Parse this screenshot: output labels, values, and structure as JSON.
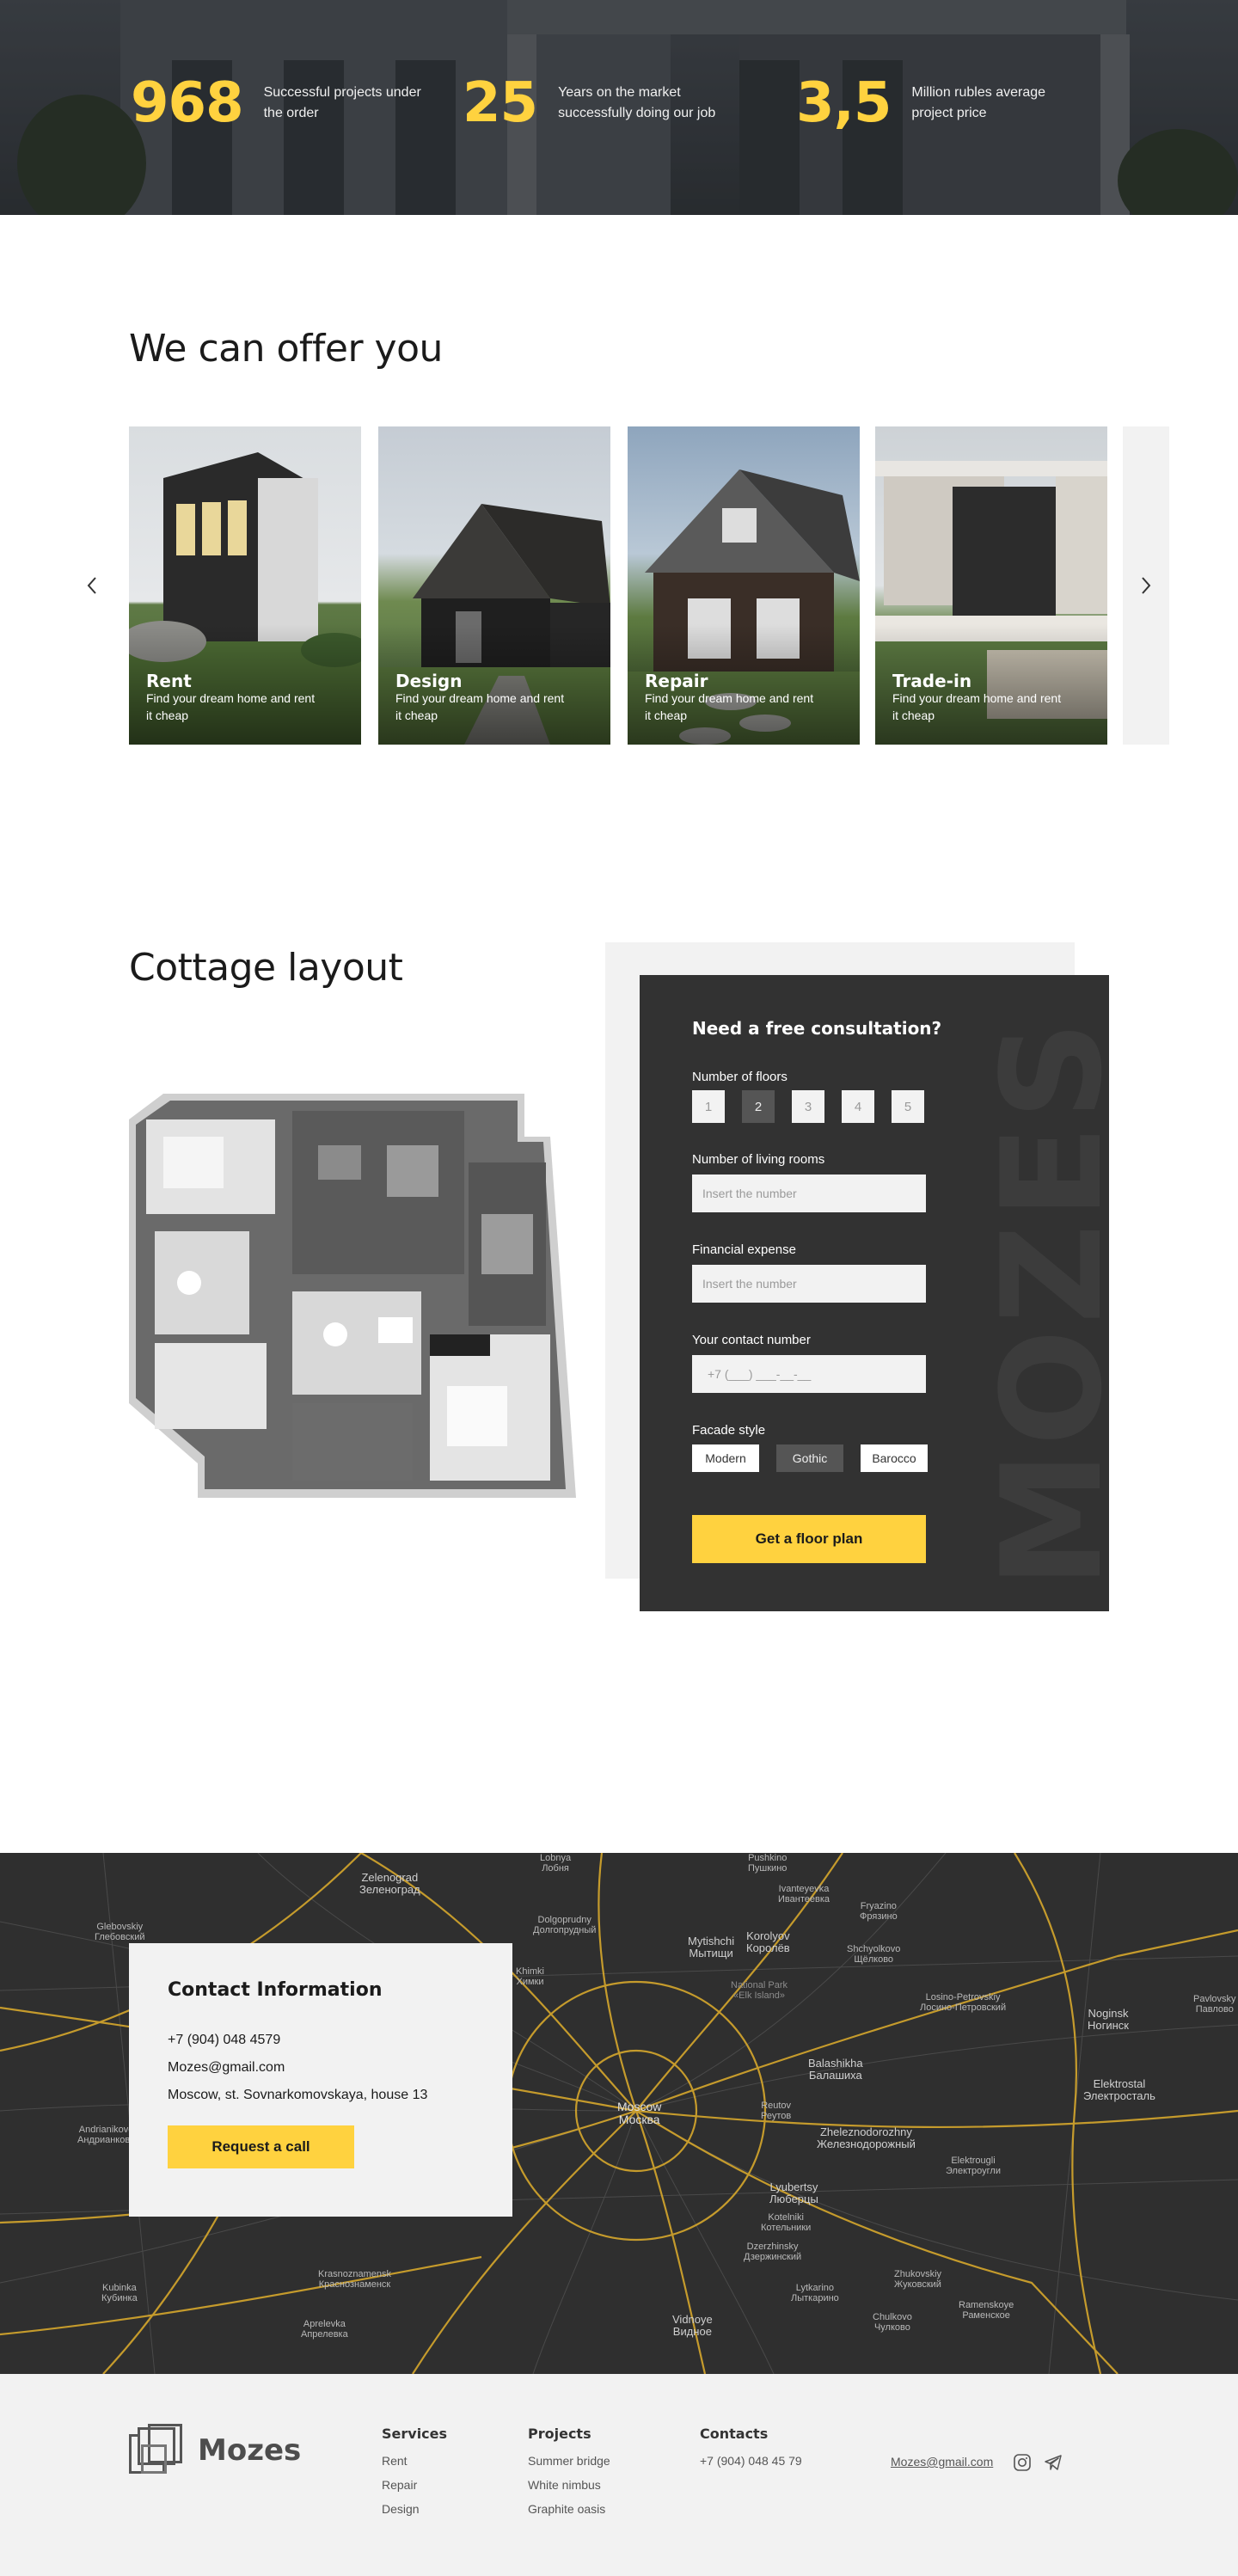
{
  "stats": [
    {
      "number": "968",
      "text": "Successful projects under the order"
    },
    {
      "number": "25",
      "text": "Years on the market successfully doing our job"
    },
    {
      "number": "3,5",
      "text": "Million rubles average project price"
    }
  ],
  "offer": {
    "title": "We can offer you",
    "cards": [
      {
        "title": "Rent",
        "desc": "Find your dream home and rent it cheap"
      },
      {
        "title": "Design",
        "desc": "Find your dream home and rent it cheap"
      },
      {
        "title": "Repair",
        "desc": "Find your dream home and rent it cheap"
      },
      {
        "title": "Trade-in",
        "desc": "Find your dream home and rent it cheap"
      }
    ],
    "prev_icon": "chevron-left-icon",
    "next_icon": "chevron-right-icon"
  },
  "layout": {
    "title": "Cottage layout"
  },
  "form": {
    "title": "Need a free consultation?",
    "brand_watermark": "MOZES",
    "floors_label": "Number of floors",
    "floors": [
      "1",
      "2",
      "3",
      "4",
      "5"
    ],
    "floors_selected": "2",
    "rooms_label": "Number of living rooms",
    "rooms_placeholder": "Insert the number",
    "expense_label": "Financial expense",
    "expense_placeholder": "Insert the number",
    "phone_label": "Your contact number",
    "phone_placeholder": "+7 (___) ___-__-__",
    "facade_label": "Facade style",
    "facades": [
      "Modern",
      "Gothic",
      "Barocco"
    ],
    "facade_selected": "Gothic",
    "submit": "Get a floor plan"
  },
  "contact": {
    "title": "Contact Information",
    "phone": "+7 (904) 048 4579",
    "email": "Mozes@gmail.com",
    "address": "Moscow, st. Sovnarkomovskaya, house 13",
    "button": "Request a call"
  },
  "map_labels": {
    "moscow": "Moscow\nМосква",
    "zelenograd": "Zelenograd\nЗеленоград",
    "mytishchi": "Mytishchi\nМытищи",
    "korolyov": "Korolyov\nКоролёв",
    "balashikha": "Balashikha\nБалашиха",
    "lyubertsy": "Lyubertsy\nЛюберцы",
    "khimki": "Khimki\nХимки",
    "dolgoprudny": "Dolgoprudny\nДолгопрудный",
    "reutov": "Reutov\nРеутов",
    "zheleznodorozhny": "Zheleznodorozhny\nЖелезнодорожный",
    "elektrostal": "Elektrostal\nЭлектросталь",
    "noginsk": "Noginsk\nНогинск",
    "shchyolkovo": "Shchyolkovo\nЩёлково",
    "pushkino": "Pushkino\nПушкино",
    "ivanteyevka": "Ivanteyevka\nИвантеевка",
    "fryazino": "Fryazino\nФрязино",
    "dzerzhinsky": "Dzerzhinsky\nДзержинский",
    "zhukovsky": "Zhukovskiy\nЖуковский",
    "vidnoye": "Vidnoye\nВидное",
    "krasnoznamensk": "Krasnoznamensk\nКраснознаменск",
    "aprelevka": "Aprelevka\nАпрелевка",
    "lobnya": "Lobnya\nЛобня",
    "ramenskoye": "Ramenskoye\nРаменское",
    "odintsovo": "Kubinka\nКубинка",
    "krasnogorsk": "Kotelniki\nКотельники",
    "elektrougli": "Elektrougli\nЭлектроугли",
    "losino": "Losino-Petrovskiy\nЛосино-Петровский",
    "national_park": "National Park\n«Elk Island»",
    "zvenigorod": "Andrianikovo\nАндрианково",
    "lytkarino": "Lytkarino\nЛыткарино",
    "chekhov": "Chulkovo\nЧулково",
    "golitsyno": "Glebovskiy\nГлебовский",
    "pavlovsky": "Pavlovsky\nПавлово"
  },
  "footer": {
    "brand": "Mozes",
    "services_title": "Services",
    "services": [
      "Rent",
      "Repair",
      "Design"
    ],
    "projects_title": "Projects",
    "projects": [
      "Summer bridge",
      "White nimbus",
      "Graphite oasis"
    ],
    "contacts_title": "Contacts",
    "phone": "+7 (904) 048 45 79",
    "email": "Mozes@gmail.com",
    "social_icons": [
      "instagram-icon",
      "telegram-icon"
    ]
  }
}
